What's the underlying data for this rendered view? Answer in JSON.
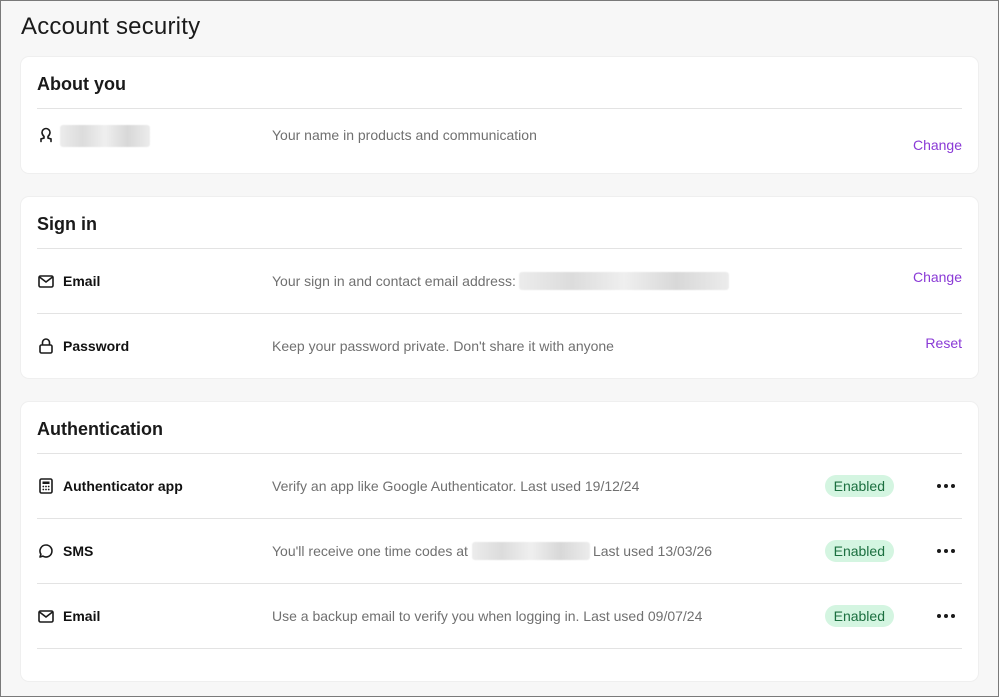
{
  "page": {
    "title": "Account security"
  },
  "about": {
    "title": "About you",
    "name_row": {
      "icon": "user-icon",
      "description": "Your name in products and communication",
      "action": "Change"
    }
  },
  "signin": {
    "title": "Sign in",
    "rows": [
      {
        "icon": "mail-icon",
        "label": "Email",
        "description": "Your sign in and contact email address:",
        "action": "Change"
      },
      {
        "icon": "lock-icon",
        "label": "Password",
        "description": "Keep your password private. Don't share it with anyone",
        "action": "Reset"
      }
    ]
  },
  "auth": {
    "title": "Authentication",
    "rows": [
      {
        "icon": "calculator-icon",
        "label": "Authenticator app",
        "description": "Verify an app like Google Authenticator. Last used 19/12/24",
        "status": "Enabled"
      },
      {
        "icon": "chat-bubble-icon",
        "label": "SMS",
        "description_prefix": "You'll receive one time codes at",
        "description_suffix": "Last used 13/03/26",
        "status": "Enabled"
      },
      {
        "icon": "mail-icon",
        "label": "Email",
        "description": "Use a backup email to verify you when logging in. Last used 09/07/24",
        "status": "Enabled"
      }
    ]
  },
  "colors": {
    "accent": "#8a3ad6",
    "badge_bg": "#d4f5e1",
    "badge_text": "#1b6f3f"
  }
}
